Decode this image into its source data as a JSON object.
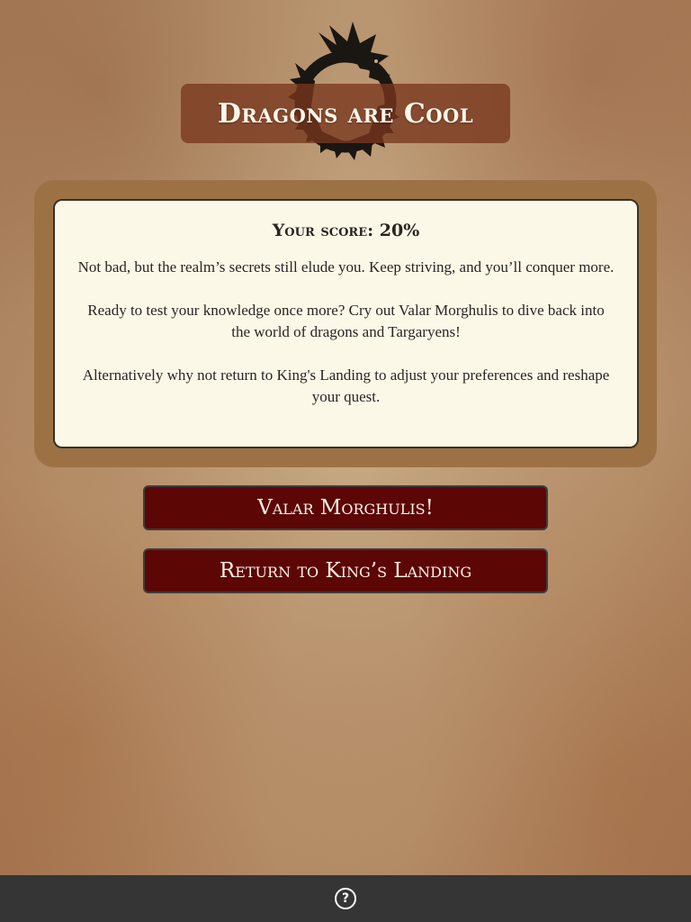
{
  "header": {
    "title": "Dragons are Cool",
    "logo_icon": "dragon-ouroboros-icon"
  },
  "result": {
    "score_label": "Your score: 20%",
    "feedback": "Not bad, but the realm’s secrets still elude you. Keep striving, and you’ll conquer more.",
    "retry_prompt": "Ready to test your knowledge once more? Cry out Valar Morghulis to dive back into the world of dragons and Targaryens!",
    "alternative": "Alternatively why not return to King's Landing to adjust your preferences and reshape your quest."
  },
  "buttons": {
    "retry_label": "Valar Morghulis!",
    "home_label": "Return to King’s Landing"
  },
  "footer": {
    "help_icon": "question-circle-icon",
    "help_glyph": "?"
  },
  "colors": {
    "title_bg": "#78371e",
    "card_frame": "#9c7245",
    "card_bg": "#fcf8e8",
    "button_bg": "#5c0606",
    "footer_bg": "#353535"
  }
}
